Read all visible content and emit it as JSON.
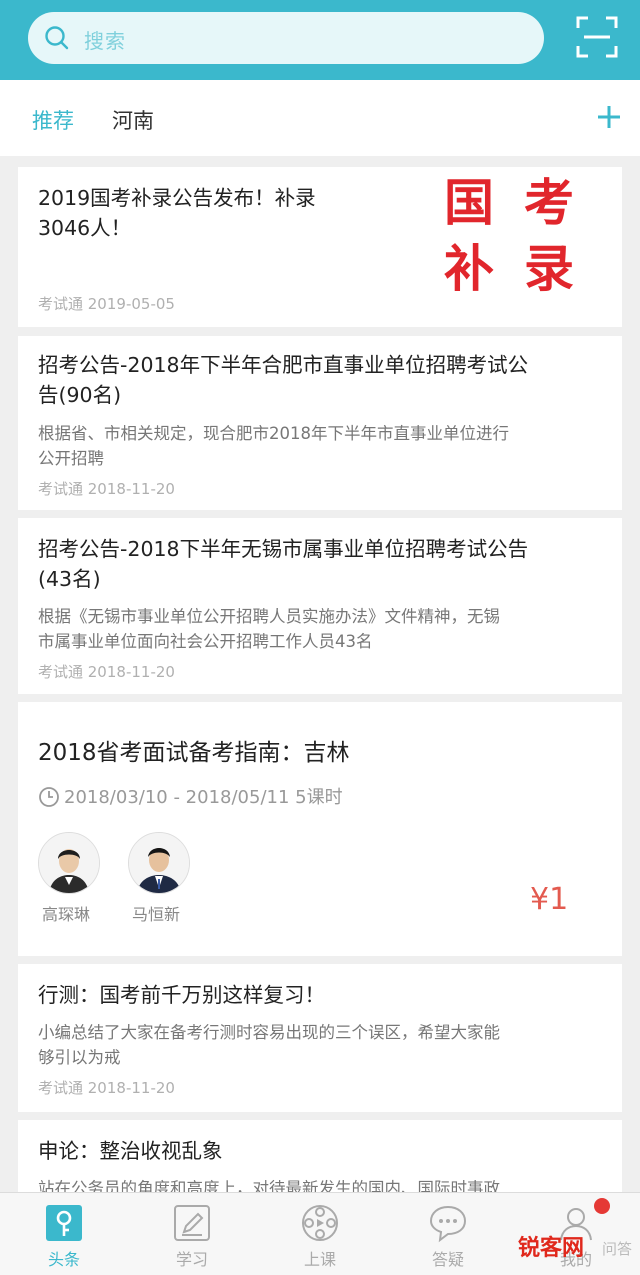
{
  "search": {
    "placeholder": "搜索"
  },
  "tabs": [
    {
      "label": "推荐",
      "active": true
    },
    {
      "label": "河南",
      "active": false
    }
  ],
  "colors": {
    "accent": "#3bb8cc",
    "price": "#e35a4f",
    "stamp": "#e1262c",
    "badge": "#e53935"
  },
  "feed": [
    {
      "title_lines": [
        "2019国考补录公告发布！补录",
        "3046人！"
      ],
      "meta": "考试通 2019-05-05",
      "stamp": [
        "国",
        "考",
        "补",
        "录"
      ]
    },
    {
      "title_lines": [
        "招考公告-2018年下半年合肥市直事业单位招聘考试公",
        "告(90名)"
      ],
      "desc_lines": [
        "根据省、市相关规定，现合肥市2018年下半年市直事业单位进行",
        "公开招聘"
      ],
      "meta": "考试通 2018-11-20"
    },
    {
      "title_lines": [
        "招考公告-2018下半年无锡市属事业单位招聘考试公告",
        "(43名)"
      ],
      "desc_lines": [
        "根据《无锡市事业单位公开招聘人员实施办法》文件精神，无锡",
        "市属事业单位面向社会公开招聘工作人员43名"
      ],
      "meta": "考试通 2018-11-20"
    },
    {
      "title": "2018省考面试备考指南：吉林",
      "schedule": "2018/03/10 - 2018/05/11 5课时",
      "teachers": [
        "高琛琳",
        "马恒新"
      ],
      "price": "¥1"
    },
    {
      "title_lines": [
        "行测：国考前千万别这样复习！"
      ],
      "desc_lines": [
        "小编总结了大家在备考行测时容易出现的三个误区，希望大家能",
        "够引以为戒"
      ],
      "meta": "考试通 2018-11-20"
    },
    {
      "title_lines": [
        "申论：整治收视乱象"
      ],
      "desc_lines": [
        "站在公务员的角度和高度上，对待最新发生的国内、国际时事政"
      ]
    }
  ],
  "bottom_nav": [
    {
      "label": "头条",
      "icon": "headline-icon",
      "active": true
    },
    {
      "label": "学习",
      "icon": "pencil-icon",
      "active": false
    },
    {
      "label": "上课",
      "icon": "film-reel-icon",
      "active": false
    },
    {
      "label": "答疑",
      "icon": "chat-bubble-icon",
      "active": false
    },
    {
      "label": "我的",
      "icon": "user-icon",
      "active": false
    }
  ],
  "watermark": {
    "main": "锐客网",
    "sub": "问答"
  }
}
